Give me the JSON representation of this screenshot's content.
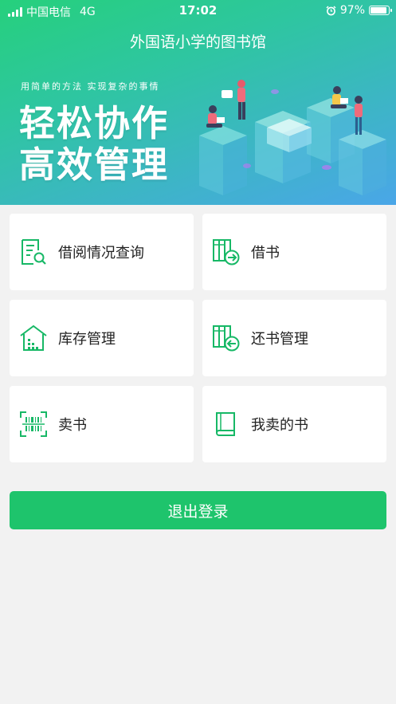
{
  "status_bar": {
    "carrier": "中国电信",
    "network": "4G",
    "time": "17:02",
    "battery": "97%"
  },
  "header": {
    "title": "外国语小学的图书馆",
    "banner": {
      "subtitle": "用简单的方法 实现复杂的事情",
      "line1": "轻松协作",
      "line2": "高效管理"
    }
  },
  "menu": {
    "borrow_query": "借阅情况查询",
    "borrow": "借书",
    "inventory": "库存管理",
    "return_mgmt": "还书管理",
    "sell": "卖书",
    "my_sold": "我卖的书"
  },
  "logout_label": "退出登录",
  "colors": {
    "accent": "#1ec46c",
    "icon": "#17b866"
  }
}
